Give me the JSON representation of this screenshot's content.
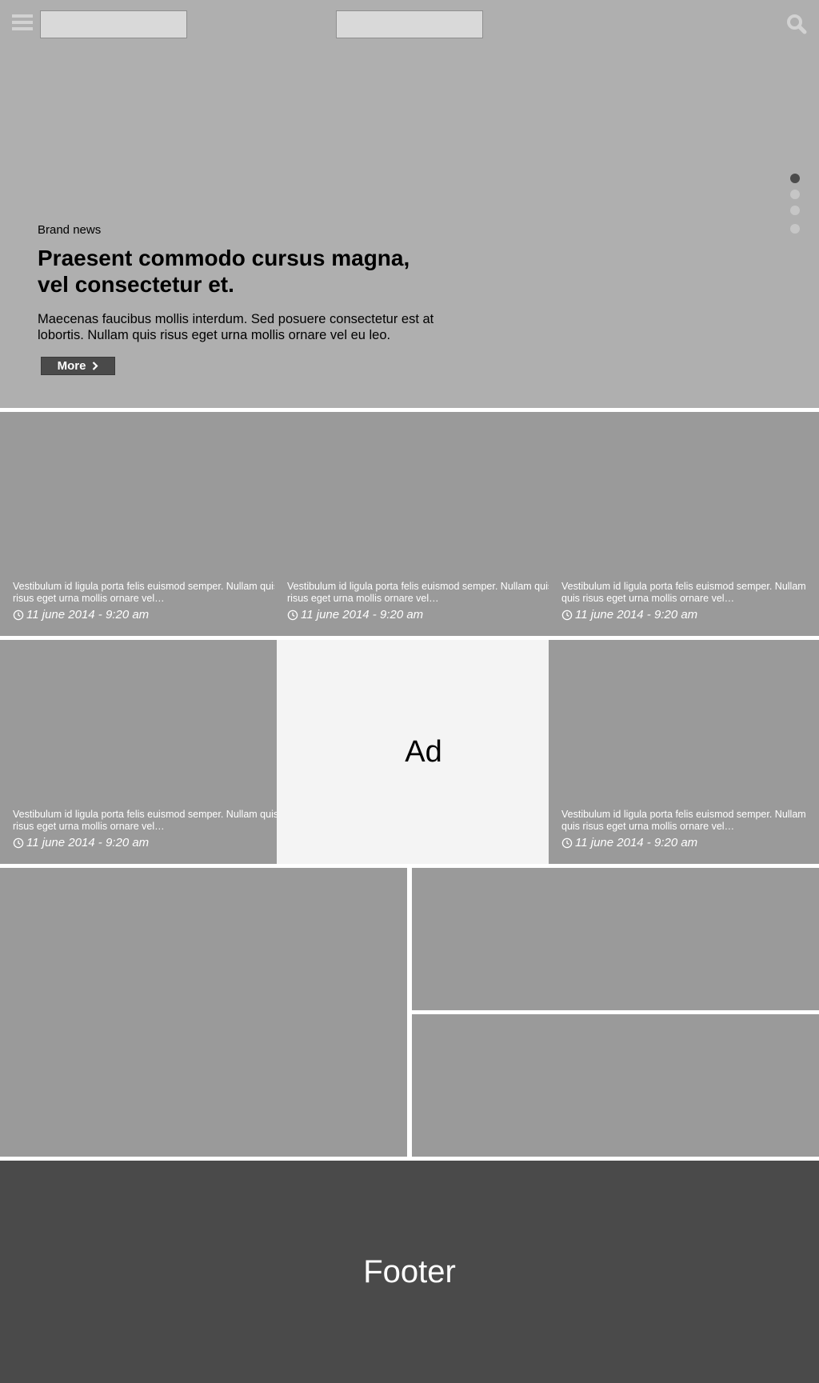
{
  "colors": {
    "hero_bg": "#afafaf",
    "tile_bg": "#9a9a9a",
    "ad_bg": "#f4f4f4",
    "footer_bg": "#4a4a4a",
    "active_dot": "#4b4b4b",
    "button_bg": "#4a4a4a"
  },
  "header": {
    "menu_icon": "hamburger-icon",
    "search_icon": "search-icon"
  },
  "carousel": {
    "slide_count": 4,
    "active_index": 0
  },
  "hero": {
    "category": "Brand news",
    "title": "Praesent commodo cursus magna, vel consectetur et.",
    "description": "Maecenas faucibus mollis interdum. Sed posuere consectetur est at lobortis. Nullam quis risus eget urna mollis ornare vel eu leo.",
    "button_label": "More",
    "button_icon": "chevron-right-icon"
  },
  "articles": [
    {
      "text": "Vestibulum id ligula porta felis euismod semper. Nullam quis risus eget urna mollis ornare vel…",
      "date": "11 june 2014 - 9:20 am"
    },
    {
      "text": "Vestibulum id ligula porta felis euismod semper. Nullam quis risus eget urna mollis ornare vel…",
      "date": "11 june 2014 - 9:20 am"
    },
    {
      "text": "Vestibulum id ligula porta felis euismod semper. Nullam quis risus eget urna mollis ornare vel…",
      "date": "11 june 2014 - 9:20 am"
    },
    {
      "text": "Vestibulum id ligula porta felis euismod semper. Nullam quis risus eget urna mollis ornare vel…",
      "date": "11 june 2014 - 9:20 am"
    },
    {
      "text": "Vestibulum id ligula porta felis euismod semper. Nullam quis risus eget urna mollis ornare vel…",
      "date": "11 june 2014 - 9:20 am"
    }
  ],
  "ad": {
    "label": "Ad"
  },
  "footer": {
    "label": "Footer"
  }
}
